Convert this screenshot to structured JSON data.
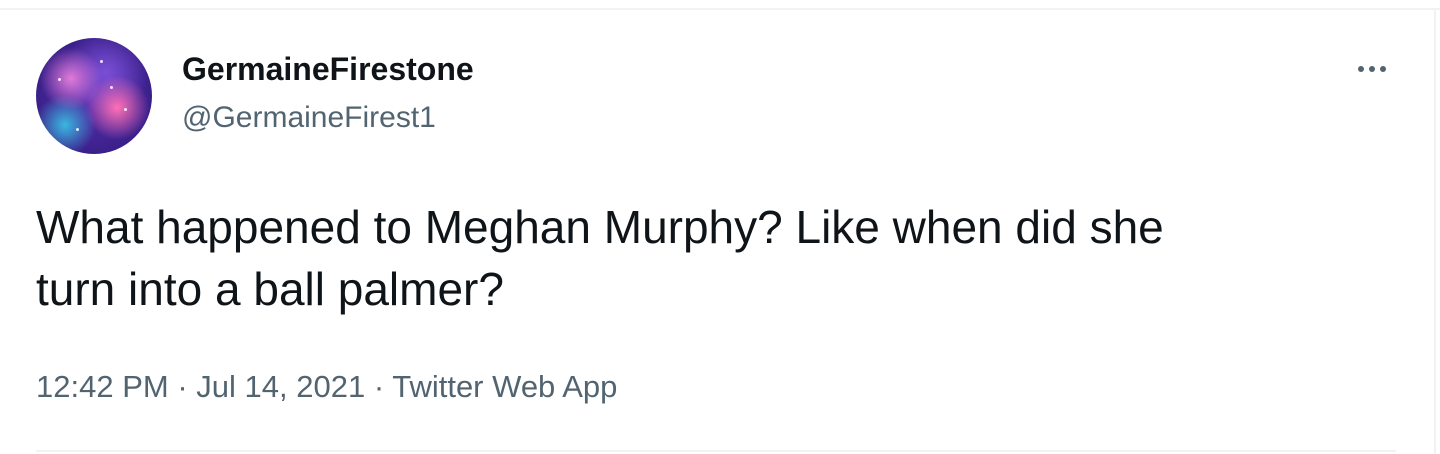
{
  "tweet": {
    "display_name": "GermaineFirestone",
    "handle": "@GermaineFirest1",
    "text_line1": "What happened to Meghan Murphy? Like when did she",
    "text_line2": "turn into a ball palmer?",
    "time": "12:42 PM",
    "separator": "·",
    "date": "Jul 14, 2021",
    "source": "Twitter Web App",
    "more_icon": "more-horizontal-icon",
    "avatar_icon": "avatar-galaxy-image"
  },
  "colors": {
    "text_primary": "#0f1419",
    "text_secondary": "#536471",
    "divider": "#eff3f4"
  }
}
